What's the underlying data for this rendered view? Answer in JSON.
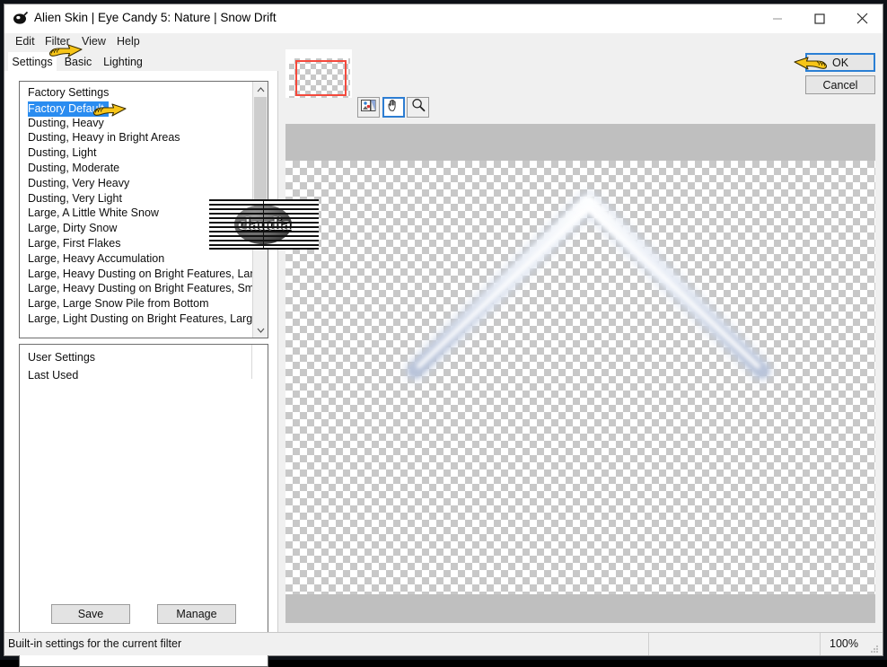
{
  "window": {
    "title": "Alien Skin | Eye Candy 5: Nature | Snow Drift",
    "app_icon": "alien-skin-icon",
    "minimize_label": "Minimize",
    "maximize_label": "Maximize",
    "close_label": "Close"
  },
  "menu": {
    "items": [
      {
        "label": "Edit"
      },
      {
        "label": "Filter"
      },
      {
        "label": "View"
      },
      {
        "label": "Help"
      }
    ]
  },
  "tabs": [
    {
      "label": "Settings",
      "active": true
    },
    {
      "label": "Basic",
      "active": false
    },
    {
      "label": "Lighting",
      "active": false
    }
  ],
  "factory_settings": {
    "header": "Factory Settings",
    "selected": "Factory Default",
    "items": [
      "Factory Default",
      "Dusting, Heavy",
      "Dusting, Heavy in Bright Areas",
      "Dusting, Light",
      "Dusting, Moderate",
      "Dusting, Very Heavy",
      "Dusting, Very Light",
      "Large, A Little White Snow",
      "Large, Dirty Snow",
      "Large, First Flakes",
      "Large, Heavy Accumulation",
      "Large, Heavy Dusting on Bright Features, Large Drift",
      "Large, Heavy Dusting on Bright Features, Small Drift",
      "Large, Large Snow Pile from Bottom",
      "Large, Light Dusting on Bright Features, Large Drift"
    ]
  },
  "user_settings": {
    "header": "User Settings",
    "items": [
      "Last Used"
    ]
  },
  "panel_buttons": {
    "save": "Save",
    "manage": "Manage"
  },
  "preview_toolbar": {
    "compare_icon": "before-after-compare-icon",
    "pan_icon": "hand-pan-icon",
    "zoom_icon": "magnifier-zoom-icon",
    "active_tool": "hand-pan-icon"
  },
  "dialog_buttons": {
    "ok": "OK",
    "cancel": "Cancel"
  },
  "statusbar": {
    "message": "Built-in settings for the current filter",
    "zoom": "100%"
  },
  "watermark": {
    "text": "claudia"
  },
  "colors": {
    "accent_blue": "#2a8cf0",
    "focus_border": "#2a7fd4",
    "nav_rect_red": "#f4493c",
    "band_gray": "#bfbfbf",
    "snow_blue": "#c6cfe2"
  }
}
